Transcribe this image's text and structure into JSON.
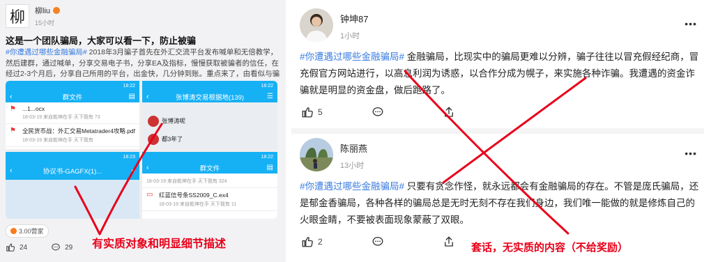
{
  "left": {
    "avatar_char": "柳",
    "username": "柳liu",
    "time": "15小时",
    "title": "这是一个团队骗局，大家可以看一下，防止被骗",
    "hashtag": "#你遭遇过哪些金融骗局#",
    "body": " 2018年3月骗子首先在外汇交流平台发布喊单和无倍教学，然后建群，通过喊单，分享交易电子书，分享EA及指标，慢慢获取被骗者的信任，在经过2-3个月后，分享自己所用的平台，出金快，几分钟到账。重点来了，由看似与骗子无...",
    "screens": {
      "s1_bar": "群文件",
      "s1_time": "18:22",
      "s1_row1": "...1...ocx",
      "s1_row1_sub": "18-03-19  来自乾坤在手  天下我有  73",
      "s1_row2": "全民货币战：外汇交易Metatrader4攻略.pdf",
      "s1_row2_sub": "18-03-19  来自乾坤在手  天下我有",
      "s2_bar": "张博涛交易根据地(139)",
      "s2_time": "18:22",
      "s2_msg1": "张博涛呢",
      "s2_msg2": "都3年了",
      "s3_bar": "协议书-GAGFX(1)...",
      "s3_time": "18:23",
      "s4_bar": "群文件",
      "s4_time": "18:22",
      "s4_row1_sub": "18-03-19  来自乾坤在手  天下我有  324",
      "s4_row2": "红蓝信号条SS2009_C.ex4",
      "s4_row2_sub": "18-03-19  来自乾坤在手  天下我有  11"
    },
    "coins": "3.00营家",
    "likes": "24",
    "comments": "29",
    "caption": "有实质对象和明显细节描述"
  },
  "post1": {
    "username": "钟坤87",
    "time": "1小时",
    "hashtag": "#你遭遇过哪些金融骗局#",
    "body": " 金融骗局，比现实中的骗局更难以分辨，骗子往往以冒充假经纪商，冒充假官方网站进行，以高息利润为诱惑，以合作分成为幌子，来实施各种诈骗。我遭遇的资金诈骗就是明显的资金盘，做后跑路了。",
    "likes": "5"
  },
  "post2": {
    "username": "陈丽燕",
    "time": "13小时",
    "hashtag": "#你遭遇过哪些金融骗局#",
    "body": " 只要有贪念作怪，就永远都会有金融骗局的存在。不管是庞氏骗局，还是郁金香骗局，各种各样的骗局总是无时无刻不存在我们身边，我们唯一能做的就是修炼自己的火眼金睛，不要被表面现象蒙蔽了双眼。",
    "likes": "2"
  },
  "more_glyph": "•••",
  "caption_right": "套话，无实质的内容（不给奖励）",
  "colors": {
    "mark_red": "#e8001a",
    "hashtag_blue": "#3b7de0",
    "app_blue": "#16b0f5"
  }
}
